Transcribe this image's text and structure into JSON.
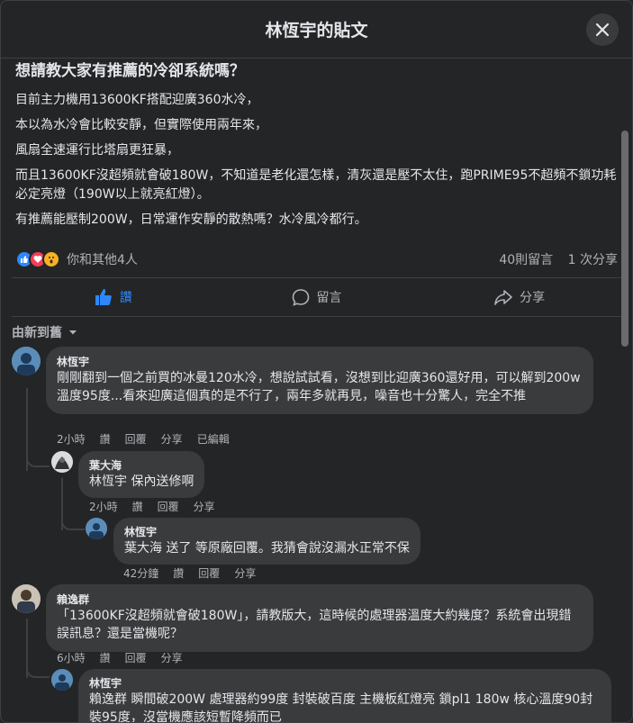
{
  "header": {
    "title": "林恆宇的貼文"
  },
  "post": {
    "title": "想請教大家有推薦的冷卻系統嗎？",
    "lines": [
      "目前主力機用13600KF搭配迎廣360水冷，",
      "本以為水冷會比較安靜，但實際使用兩年來，",
      "風扇全速運行比塔扇更狂暴，",
      "而且13600KF沒超頻就會破180W，不知道是老化還怎樣，清灰還是壓不太住，跑PRIME95不超頻不鎖功耗必定亮燈（190W以上就亮紅燈）。",
      "有推薦能壓制200W，日常運作安靜的散熱嗎？水冷風冷都行。"
    ],
    "reactions_text": "你和其他4人",
    "comments_count": "40則留言",
    "shares_count": "1 次分享"
  },
  "actions": {
    "like": "讚",
    "comment": "留言",
    "share": "分享"
  },
  "sort_label": "由新到舊",
  "comments": [
    {
      "author": "林恆宇",
      "text": "剛剛翻到一個之前買的冰曼120水冷，想說試試看，沒想到比迎廣360還好用，可以解到200w 溫度95度...看來迎廣這個真的是不行了，兩年多就再見，噪音也十分驚人，完全不推",
      "time": "2小時",
      "like": "讚",
      "reply": "回覆",
      "share": "分享",
      "edited": "已編輯"
    },
    {
      "author": "葉大海",
      "text": "林恆宇 保內送修啊",
      "time": "2小時",
      "like": "讚",
      "reply": "回覆",
      "share": "分享"
    },
    {
      "author": "林恆宇",
      "text": "葉大海 送了 等原廠回覆。我猜會說沒漏水正常不保",
      "time": "42分鐘",
      "like": "讚",
      "reply": "回覆",
      "share": "分享"
    },
    {
      "author": "賴逸群",
      "text": "「13600KF沒超頻就會破180W」，請教版大，這時候的處理器溫度大約幾度？系統會出現錯誤訊息？還是當機呢？",
      "time": "6小時",
      "like": "讚",
      "reply": "回覆",
      "share": "分享"
    },
    {
      "author": "林恆宇",
      "text": "賴逸群 瞬間破200W 處理器約99度 封裝破百度 主機板紅燈亮 鎖pl1 180w 核心溫度90封裝95度，沒當機應該短暫降頻而已"
    }
  ]
}
